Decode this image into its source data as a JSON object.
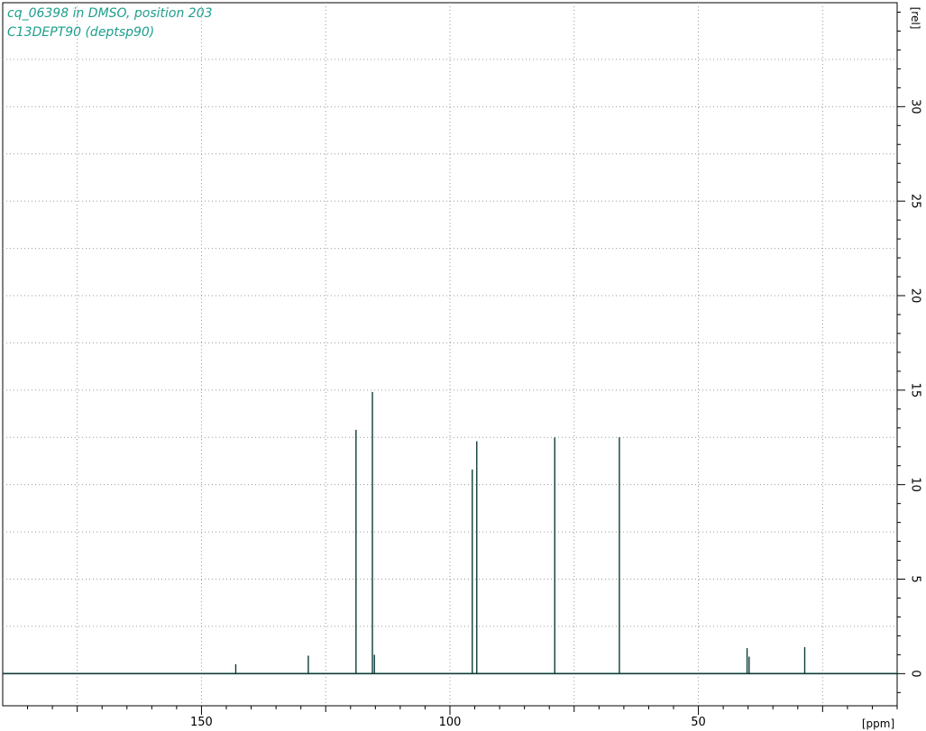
{
  "header": {
    "line1": "cq_06398 in DMSO, position 203",
    "line2": "C13DEPT90 (deptsp90)"
  },
  "colors": {
    "spectrum": "#0e3d3a",
    "title": "#1e9e8c",
    "grid": "#9a9a9a",
    "axis": "#000000"
  },
  "chart_data": {
    "type": "line",
    "title": "cq_06398 in DMSO, position 203",
    "subtitle": "C13DEPT90 (deptsp90)",
    "xlabel": "[ppm]",
    "ylabel": "[rel]",
    "x_reversed": true,
    "xlim": [
      190,
      10
    ],
    "ylim": [
      -1.7,
      35.5
    ],
    "xticks": [
      150,
      100,
      50
    ],
    "yticks": [
      0,
      5,
      10,
      15,
      20,
      25,
      30
    ],
    "grid": true,
    "series": [
      {
        "peaks": [
          {
            "ppm": 143.1,
            "height": 0.5
          },
          {
            "ppm": 128.5,
            "height": 0.95
          },
          {
            "ppm": 118.9,
            "height": 12.9
          },
          {
            "ppm": 115.6,
            "height": 14.9
          },
          {
            "ppm": 115.2,
            "height": 1.0
          },
          {
            "ppm": 95.5,
            "height": 10.8
          },
          {
            "ppm": 94.6,
            "height": 12.3
          },
          {
            "ppm": 78.9,
            "height": 12.5
          },
          {
            "ppm": 65.9,
            "height": 12.5
          },
          {
            "ppm": 40.2,
            "height": 1.35
          },
          {
            "ppm": 39.8,
            "height": 0.9
          },
          {
            "ppm": 28.6,
            "height": 1.4
          }
        ]
      }
    ]
  }
}
